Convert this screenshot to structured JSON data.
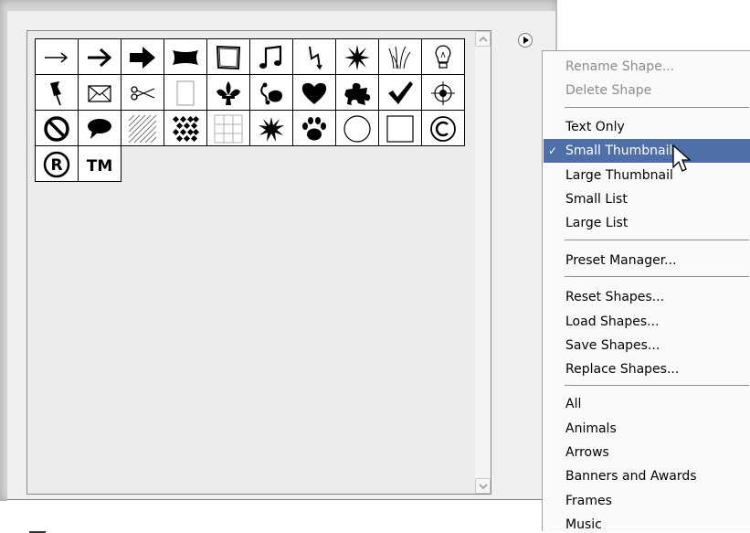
{
  "shapes": [
    {
      "name": "Arrow 1"
    },
    {
      "name": "Arrow 2"
    },
    {
      "name": "Arrow 3"
    },
    {
      "name": "Banner"
    },
    {
      "name": "Frame"
    },
    {
      "name": "Music note"
    },
    {
      "name": "Lightning"
    },
    {
      "name": "Sunburst"
    },
    {
      "name": "Grass"
    },
    {
      "name": "Light bulb"
    },
    {
      "name": "Pushpin"
    },
    {
      "name": "Envelope"
    },
    {
      "name": "Scissors"
    },
    {
      "name": "Blank page"
    },
    {
      "name": "Fleur-de-lis"
    },
    {
      "name": "Ornament"
    },
    {
      "name": "Heart"
    },
    {
      "name": "Puzzle"
    },
    {
      "name": "Checkmark"
    },
    {
      "name": "Target"
    },
    {
      "name": "No symbol"
    },
    {
      "name": "Speech bubble"
    },
    {
      "name": "Hatched square"
    },
    {
      "name": "Dots grid"
    },
    {
      "name": "Grid"
    },
    {
      "name": "Starburst"
    },
    {
      "name": "Paw print"
    },
    {
      "name": "Circle"
    },
    {
      "name": "Square"
    },
    {
      "name": "Copyright"
    },
    {
      "name": "Registered",
      "glyph": "®"
    },
    {
      "name": "Trademark",
      "glyph": "TM"
    }
  ],
  "menu": {
    "items": [
      {
        "label": "Rename Shape...",
        "disabled": true
      },
      {
        "label": "Delete Shape",
        "disabled": true
      },
      {
        "label": "Text Only"
      },
      {
        "label": "Small Thumbnail",
        "checked": true,
        "selected": true
      },
      {
        "label": "Large Thumbnail"
      },
      {
        "label": "Small List"
      },
      {
        "label": "Large List"
      },
      {
        "label": "Preset Manager..."
      },
      {
        "label": "Reset Shapes..."
      },
      {
        "label": "Load Shapes..."
      },
      {
        "label": "Save Shapes..."
      },
      {
        "label": "Replace Shapes..."
      },
      {
        "label": "All"
      },
      {
        "label": "Animals"
      },
      {
        "label": "Arrows"
      },
      {
        "label": "Banners and Awards"
      },
      {
        "label": "Frames"
      },
      {
        "label": "Music"
      }
    ],
    "check_glyph": "✓"
  },
  "colors": {
    "selection": "#4f6fa8",
    "disabled_text": "#8c8c8c"
  }
}
